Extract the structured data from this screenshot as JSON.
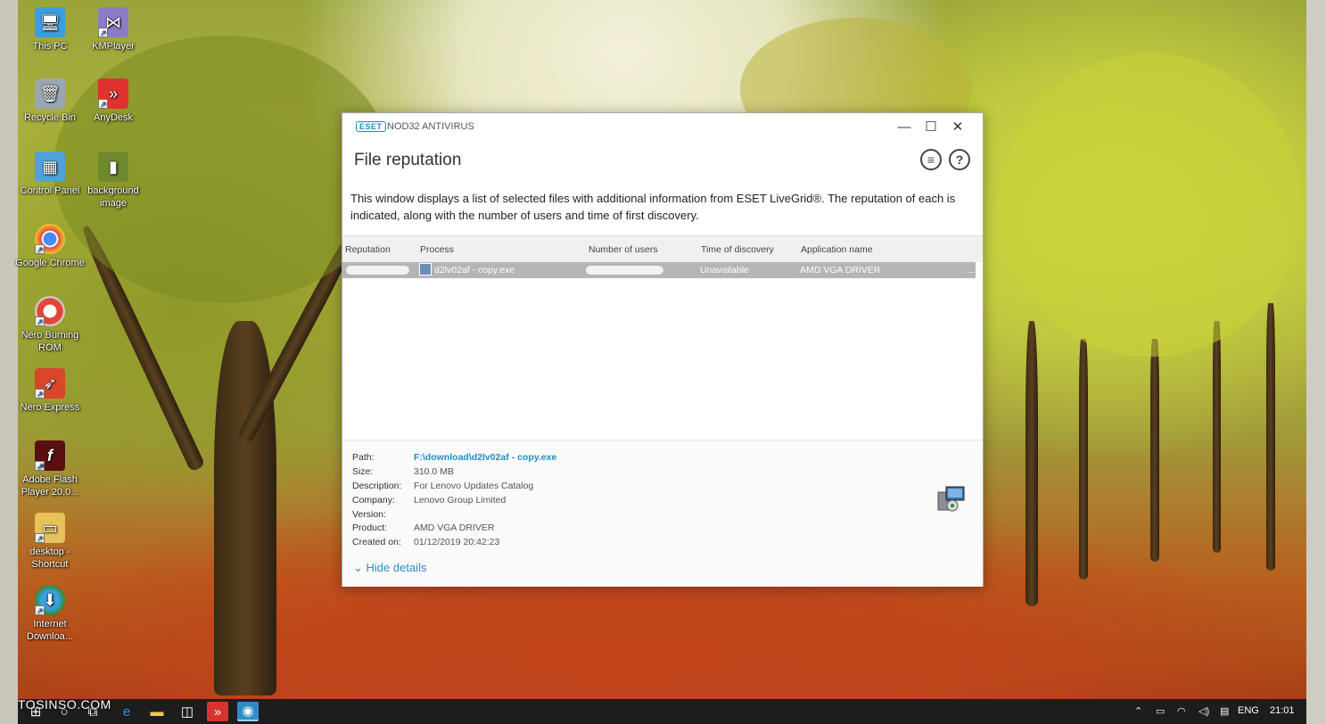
{
  "desktop_icons": [
    {
      "label": "This PC",
      "icon": "this-pc-icon"
    },
    {
      "label": "KMPlayer",
      "icon": "kmplayer-icon"
    },
    {
      "label": "Recycle Bin",
      "icon": "recycle-bin-icon"
    },
    {
      "label": "AnyDesk",
      "icon": "anydesk-icon"
    },
    {
      "label": "Control Panel",
      "icon": "control-panel-icon"
    },
    {
      "label": "background image",
      "icon": "image-file-icon"
    },
    {
      "label": "Google Chrome",
      "icon": "chrome-icon"
    },
    {
      "label": "Nero Burning ROM",
      "icon": "nero-burning-icon"
    },
    {
      "label": "Nero Express",
      "icon": "nero-express-icon"
    },
    {
      "label": "Adobe Flash Player 20.0...",
      "icon": "flash-icon"
    },
    {
      "label": "desktop - Shortcut",
      "icon": "folder-shortcut-icon"
    },
    {
      "label": "Internet Downloa...",
      "icon": "idm-icon"
    }
  ],
  "window": {
    "logo": "ESET",
    "product": "NOD32 ANTIVIRUS",
    "minimize": "—",
    "maximize": "☐",
    "close": "✕",
    "title": "File reputation",
    "description": "This window displays a list of selected files with additional information from ESET LiveGrid®. The reputation of each is indicated, along with the number of users and time of first discovery."
  },
  "table": {
    "columns": [
      "Reputation",
      "Process",
      "Number of users",
      "Time of discovery",
      "Application name"
    ],
    "rows": [
      {
        "reputation": "",
        "process": "d2lv02af - copy.exe",
        "users": "",
        "time": "Unavailable",
        "application": "AMD VGA DRIVER",
        "more": "..."
      }
    ]
  },
  "details": {
    "labels": {
      "path": "Path:",
      "size": "Size:",
      "description": "Description:",
      "company": "Company:",
      "version": "Version:",
      "product": "Product:",
      "created": "Created on:"
    },
    "values": {
      "path": "F:\\download\\d2lv02af - copy.exe",
      "size": "310.0 MB",
      "description": "For Lenovo Updates Catalog",
      "company": "Lenovo Group Limited",
      "version": "",
      "product": "AMD VGA DRIVER",
      "created": "01/12/2019 20:42:23"
    },
    "hide_details": "Hide details"
  },
  "taskbar": {
    "watermark": "TOSINSO.COM",
    "language": "ENG",
    "time": "21:01"
  },
  "colors": {
    "accent": "#1d8fbf",
    "row_selected": "#b5b5b5",
    "taskbar": "#1d1d1d"
  }
}
